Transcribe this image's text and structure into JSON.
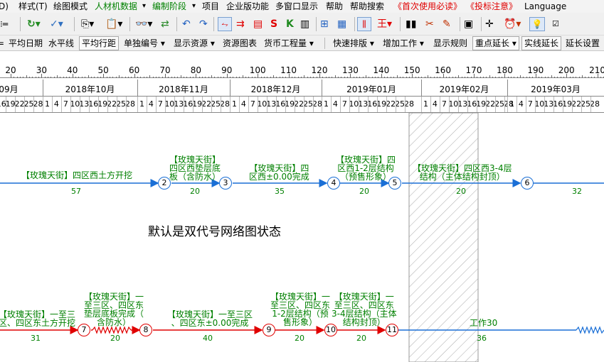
{
  "menu": [
    {
      "label": "D)",
      "color": "#000000"
    },
    {
      "label": "样式(T)",
      "color": "#000000"
    },
    {
      "label": "绘图模式",
      "color": "#000000"
    },
    {
      "label": "人材机数据",
      "color": "#008000"
    },
    {
      "label": "▾",
      "color": "#000000"
    },
    {
      "label": "编制阶段",
      "color": "#008000"
    },
    {
      "label": "▾",
      "color": "#000000"
    },
    {
      "label": "项目",
      "color": "#000000"
    },
    {
      "label": "企业版功能",
      "color": "#000000"
    },
    {
      "label": "多窗口显示",
      "color": "#000000"
    },
    {
      "label": "帮助",
      "color": "#000000"
    },
    {
      "label": "帮助搜索",
      "color": "#000000"
    },
    {
      "label": "《首次使用必读》",
      "color": "#e00000"
    },
    {
      "label": "《投标注意》",
      "color": "#e00000"
    },
    {
      "label": "Language",
      "color": "#000000"
    }
  ],
  "toolbar2": [
    {
      "label": "平均日期",
      "boxed": false
    },
    {
      "label": "水平线",
      "boxed": false
    },
    {
      "label": "平均行距",
      "boxed": true
    },
    {
      "label": "单独编号 ▾",
      "boxed": false
    },
    {
      "label": "显示资源 ▾",
      "boxed": false
    },
    {
      "label": "资源图表",
      "boxed": false
    },
    {
      "label": "货币工程量 ▾",
      "boxed": false
    },
    {
      "label": "快速排版 ▾",
      "boxed": false
    },
    {
      "label": "增加工作 ▾",
      "boxed": false
    },
    {
      "label": "显示规则",
      "boxed": false
    },
    {
      "label": "重点延长 ▾",
      "boxed": true
    },
    {
      "label": "实线延长",
      "boxed": true
    },
    {
      "label": "延长设置",
      "boxed": false
    }
  ],
  "ruler": [
    "20",
    "30",
    "40",
    "50",
    "60",
    "70",
    "80",
    "90",
    "100",
    "110",
    "120",
    "130",
    "140",
    "150",
    "160",
    "170",
    "180",
    "190",
    "200",
    "210"
  ],
  "months": [
    "09月",
    "2018年10月",
    "2018年11月",
    "2018年12月",
    "2019年01月",
    "2019年02月",
    "2019年03月"
  ],
  "day_labels": [
    "16",
    "19",
    "22",
    "25",
    "28",
    "1",
    "4",
    "7",
    "10",
    "13",
    "16",
    "19",
    "22",
    "25",
    "28"
  ],
  "note": "默认是双代号网络图状态",
  "network": {
    "row1": {
      "nodes": [
        "2",
        "3",
        "4",
        "5",
        "6"
      ],
      "tasks": [
        {
          "label": "【玫瑰天街】四区西土方开挖",
          "duration": "57"
        },
        {
          "label": "【玫瑰天街】\n四区西垫层底\n板（含防水）",
          "duration": "20"
        },
        {
          "label": "【玫瑰天街】四\n区西±0.00完成",
          "duration": "35"
        },
        {
          "label": "【玫瑰天街】四\n区西1-2层结构\n（预售形象）",
          "duration": "20"
        },
        {
          "label": "【玫瑰天街】四区西3-4层\n结构（主体结构封顶）",
          "duration": "20"
        },
        {
          "label": "",
          "duration": "32"
        }
      ]
    },
    "row2": {
      "nodes": [
        "7",
        "8",
        "9",
        "10",
        "11"
      ],
      "tasks": [
        {
          "label": "【玫瑰天街】一至三\n区、四区东土方开挖",
          "duration": "31"
        },
        {
          "label": "【玫瑰天街】一\n至三区、四区东\n垫层底板完成（\n含防水）",
          "duration": "20"
        },
        {
          "label": "【玫瑰天街】一至三区\n、四区东±0.00完成",
          "duration": "40"
        },
        {
          "label": "【玫瑰天街】一\n至三区、四区东\n1-2层结构（预\n售形象）",
          "duration": "20"
        },
        {
          "label": "【玫瑰天街】一\n至三区、四区东\n3-4层结构（主体\n结构封顶）",
          "duration": "20"
        },
        {
          "label": "工作30",
          "duration": "36"
        }
      ]
    }
  },
  "colors": {
    "blue_line": "#1a6fd6",
    "red_line": "#e00000",
    "label_green": "#008000",
    "hatch": "#aaaaaa"
  }
}
